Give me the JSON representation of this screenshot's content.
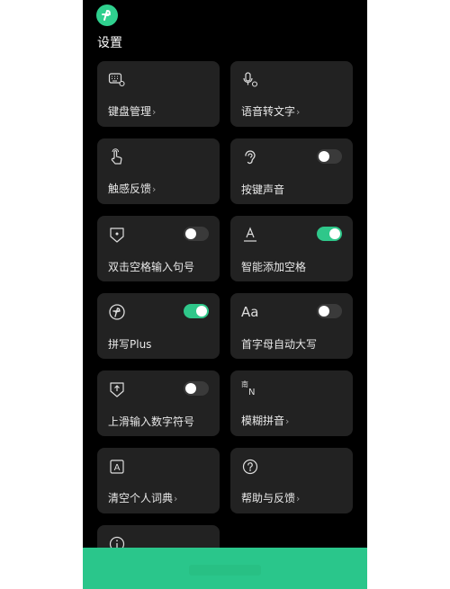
{
  "page": {
    "title": "设置"
  },
  "cards": {
    "keyboard": {
      "label": "键盘管理",
      "chevron": "›"
    },
    "voice": {
      "label": "语音转文字",
      "chevron": "›"
    },
    "haptic": {
      "label": "触感反馈",
      "chevron": "›"
    },
    "keysound": {
      "label": "按键声音",
      "toggle": false
    },
    "doublespace": {
      "label": "双击空格输入句号",
      "toggle": false
    },
    "smartspace": {
      "label": "智能添加空格",
      "toggle": true
    },
    "pinyinplus": {
      "label": "拼写Plus",
      "toggle": true
    },
    "autocap": {
      "label": "首字母自动大写",
      "toggle": false
    },
    "swipeup": {
      "label": "上滑输入数字符号",
      "toggle": false
    },
    "fuzzy": {
      "label": "模糊拼音",
      "chevron": "›"
    },
    "cleardict": {
      "label": "清空个人词典",
      "chevron": "›"
    },
    "help": {
      "label": "帮助与反馈",
      "chevron": "›"
    },
    "about": {
      "label": ""
    }
  },
  "icons": {
    "aa": "Aa",
    "a": "A",
    "fuzzy_top": "南",
    "fuzzy_bottom": "N"
  },
  "colors": {
    "accent": "#2fc78a",
    "card": "#222222",
    "background": "#000000"
  }
}
